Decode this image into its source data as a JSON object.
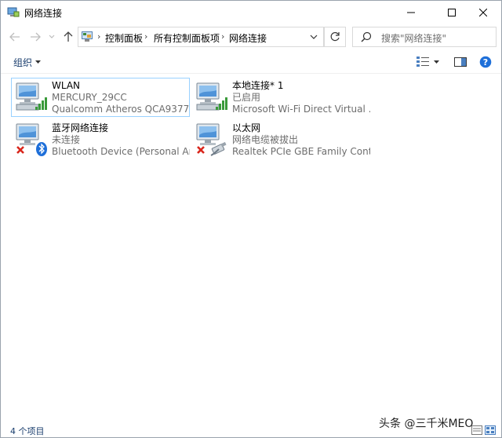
{
  "window": {
    "title": "网络连接",
    "controls": {
      "minimize": "minimize",
      "maximize": "maximize",
      "close": "close"
    }
  },
  "nav": {
    "breadcrumbs": [
      "控制面板",
      "所有控制面板项",
      "网络连接"
    ],
    "search_placeholder": "搜索\"网络连接\""
  },
  "toolbar": {
    "organize_label": "组织"
  },
  "connections": [
    {
      "name": "WLAN",
      "status": "MERCURY_29CC",
      "device": "Qualcomm Atheros QCA9377 ...",
      "icon": "wifi-adapter-icon",
      "selected": true
    },
    {
      "name": "本地连接* 1",
      "status": "已启用",
      "device": "Microsoft Wi-Fi Direct Virtual ...",
      "icon": "wifi-adapter-icon",
      "selected": false
    },
    {
      "name": "蓝牙网络连接",
      "status": "未连接",
      "device": "Bluetooth Device (Personal Ar...",
      "icon": "bluetooth-adapter-icon",
      "selected": false
    },
    {
      "name": "以太网",
      "status": "网络电缆被拔出",
      "device": "Realtek PCIe GBE Family Contr...",
      "icon": "ethernet-adapter-icon",
      "selected": false
    }
  ],
  "statusbar": {
    "item_count": "4 个项目"
  },
  "watermark": "头条 @三千米MEO",
  "colors": {
    "selection_border": "#99d1ff",
    "link_text": "#1a3e6e",
    "signal_green": "#3a9a3a",
    "error_red": "#d9261c",
    "bluetooth_blue": "#1e6fd9"
  }
}
